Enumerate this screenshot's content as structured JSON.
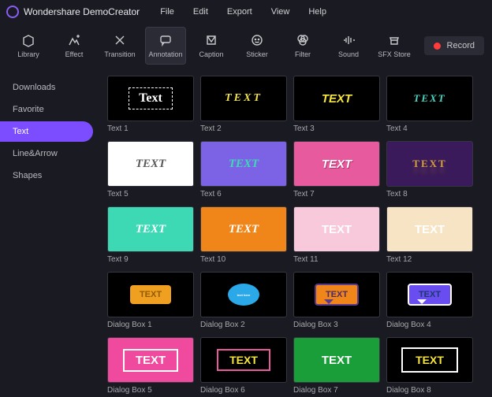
{
  "app": {
    "title": "Wondershare DemoCreator"
  },
  "menu": [
    "File",
    "Edit",
    "Export",
    "View",
    "Help"
  ],
  "toolbar": [
    {
      "name": "library",
      "label": "Library"
    },
    {
      "name": "effect",
      "label": "Effect"
    },
    {
      "name": "transition",
      "label": "Transition"
    },
    {
      "name": "annotation",
      "label": "Annotation",
      "active": true
    },
    {
      "name": "caption",
      "label": "Caption"
    },
    {
      "name": "sticker",
      "label": "Sticker"
    },
    {
      "name": "filter",
      "label": "Filter"
    },
    {
      "name": "sound",
      "label": "Sound"
    },
    {
      "name": "sfx-store",
      "label": "SFX Store"
    }
  ],
  "record_label": "Record",
  "sidebar": [
    {
      "label": "Downloads"
    },
    {
      "label": "Favorite"
    },
    {
      "label": "Text",
      "active": true
    },
    {
      "label": "Line&Arrow"
    },
    {
      "label": "Shapes"
    }
  ],
  "grid": [
    {
      "label": "Text 1",
      "text": "Text",
      "bg": "#000",
      "fg": "#fff",
      "style": "font-family:Georgia,serif;font-size:16px;border:1px dashed #fff;padding:4px 12px;"
    },
    {
      "label": "Text 2",
      "text": "TEXT",
      "bg": "#000",
      "fg": "#f2e24a",
      "style": "font-style:italic;font-family:serif;letter-spacing:3px;font-size:14px;"
    },
    {
      "label": "Text 3",
      "text": "TEXT",
      "bg": "#000",
      "fg": "#f6e53c",
      "style": "font-style:italic;font-weight:bold;font-size:15px;"
    },
    {
      "label": "Text 4",
      "text": "TEXT",
      "bg": "#000",
      "fg": "#4dd6c1",
      "style": "font-style:italic;font-family:serif;letter-spacing:2px;font-size:13px;"
    },
    {
      "label": "Text 5",
      "text": "TEXT",
      "bg": "#fff",
      "fg": "#5a5a5a",
      "style": "font-style:italic;font-family:cursive;font-size:15px;"
    },
    {
      "label": "Text 6",
      "text": "TEXT",
      "bg": "#7c63e6",
      "fg": "#3dd9b4",
      "style": "font-style:italic;font-family:cursive;font-weight:bold;font-size:15px;"
    },
    {
      "label": "Text 7",
      "text": "TEXT",
      "bg": "#e85a9e",
      "fg": "#fff",
      "style": "font-style:italic;font-weight:bold;font-size:15px;text-shadow:1px 1px 0 #b03070;"
    },
    {
      "label": "Text 8",
      "text": "TEXT",
      "bg": "#3a1a5a",
      "fg": "#d6a03a",
      "style": "font-family:serif;letter-spacing:2px;font-size:13px;text-shadow:0 8px 6px rgba(214,160,58,.25);"
    },
    {
      "label": "Text 9",
      "text": "TEXT",
      "bg": "#3dd9b4",
      "fg": "#fff",
      "style": "font-style:italic;font-family:cursive;font-size:15px;"
    },
    {
      "label": "Text 10",
      "text": "TEXT",
      "bg": "#f0861a",
      "fg": "#fff",
      "style": "font-style:italic;font-family:cursive;font-size:15px;"
    },
    {
      "label": "Text 11",
      "text": "TEXT",
      "bg": "#f7c9da",
      "fg": "#fff",
      "style": "font-weight:900;font-size:15px;"
    },
    {
      "label": "Text 12",
      "text": "TEXT",
      "bg": "#f7e4c4",
      "fg": "#fff",
      "style": "font-weight:900;font-size:15px;"
    },
    {
      "label": "Dialog Box 1",
      "text": "TEXT",
      "bg": "#000",
      "bubble": true,
      "bubbleBg": "#f0a020",
      "bubbleFg": "#925a00"
    },
    {
      "label": "Dialog Box 2",
      "text": "text here",
      "bg": "#000",
      "roundBubble": true,
      "bubbleBg": "#2aa8e8",
      "bubbleFg": "#fff"
    },
    {
      "label": "Dialog Box 3",
      "text": "TEXT",
      "bg": "#000",
      "bubble": true,
      "bubbleBg": "#f0861a",
      "bubbleFg": "#4a2a6a",
      "bubbleBorder": "#5a3a8a"
    },
    {
      "label": "Dialog Box 4",
      "text": "TEXT",
      "bg": "#000",
      "bubble": true,
      "bubbleBg": "#6a4df0",
      "bubbleFg": "#1a3a6a",
      "bubbleBorder": "#fff"
    },
    {
      "label": "Dialog Box 5",
      "text": "TEXT",
      "bg": "#f04a9e",
      "fg": "#fff",
      "style": "font-weight:900;font-size:15px;border:2px solid #fff;padding:4px 14px;"
    },
    {
      "label": "Dialog Box 6",
      "text": "TEXT",
      "bg": "#000",
      "fg": "#f6e53c",
      "style": "font-weight:900;font-size:14px;border:2px solid #e85a9e;padding:4px 14px;"
    },
    {
      "label": "Dialog Box 7",
      "text": "TEXT",
      "bg": "#1a9e3a",
      "fg": "#fff",
      "style": "font-weight:900;font-size:15px;"
    },
    {
      "label": "Dialog Box 8",
      "text": "TEXT",
      "bg": "#000",
      "fg": "#f6e53c",
      "style": "font-weight:900;font-size:14px;border:2px solid #fff;padding:6px 16px;"
    }
  ]
}
